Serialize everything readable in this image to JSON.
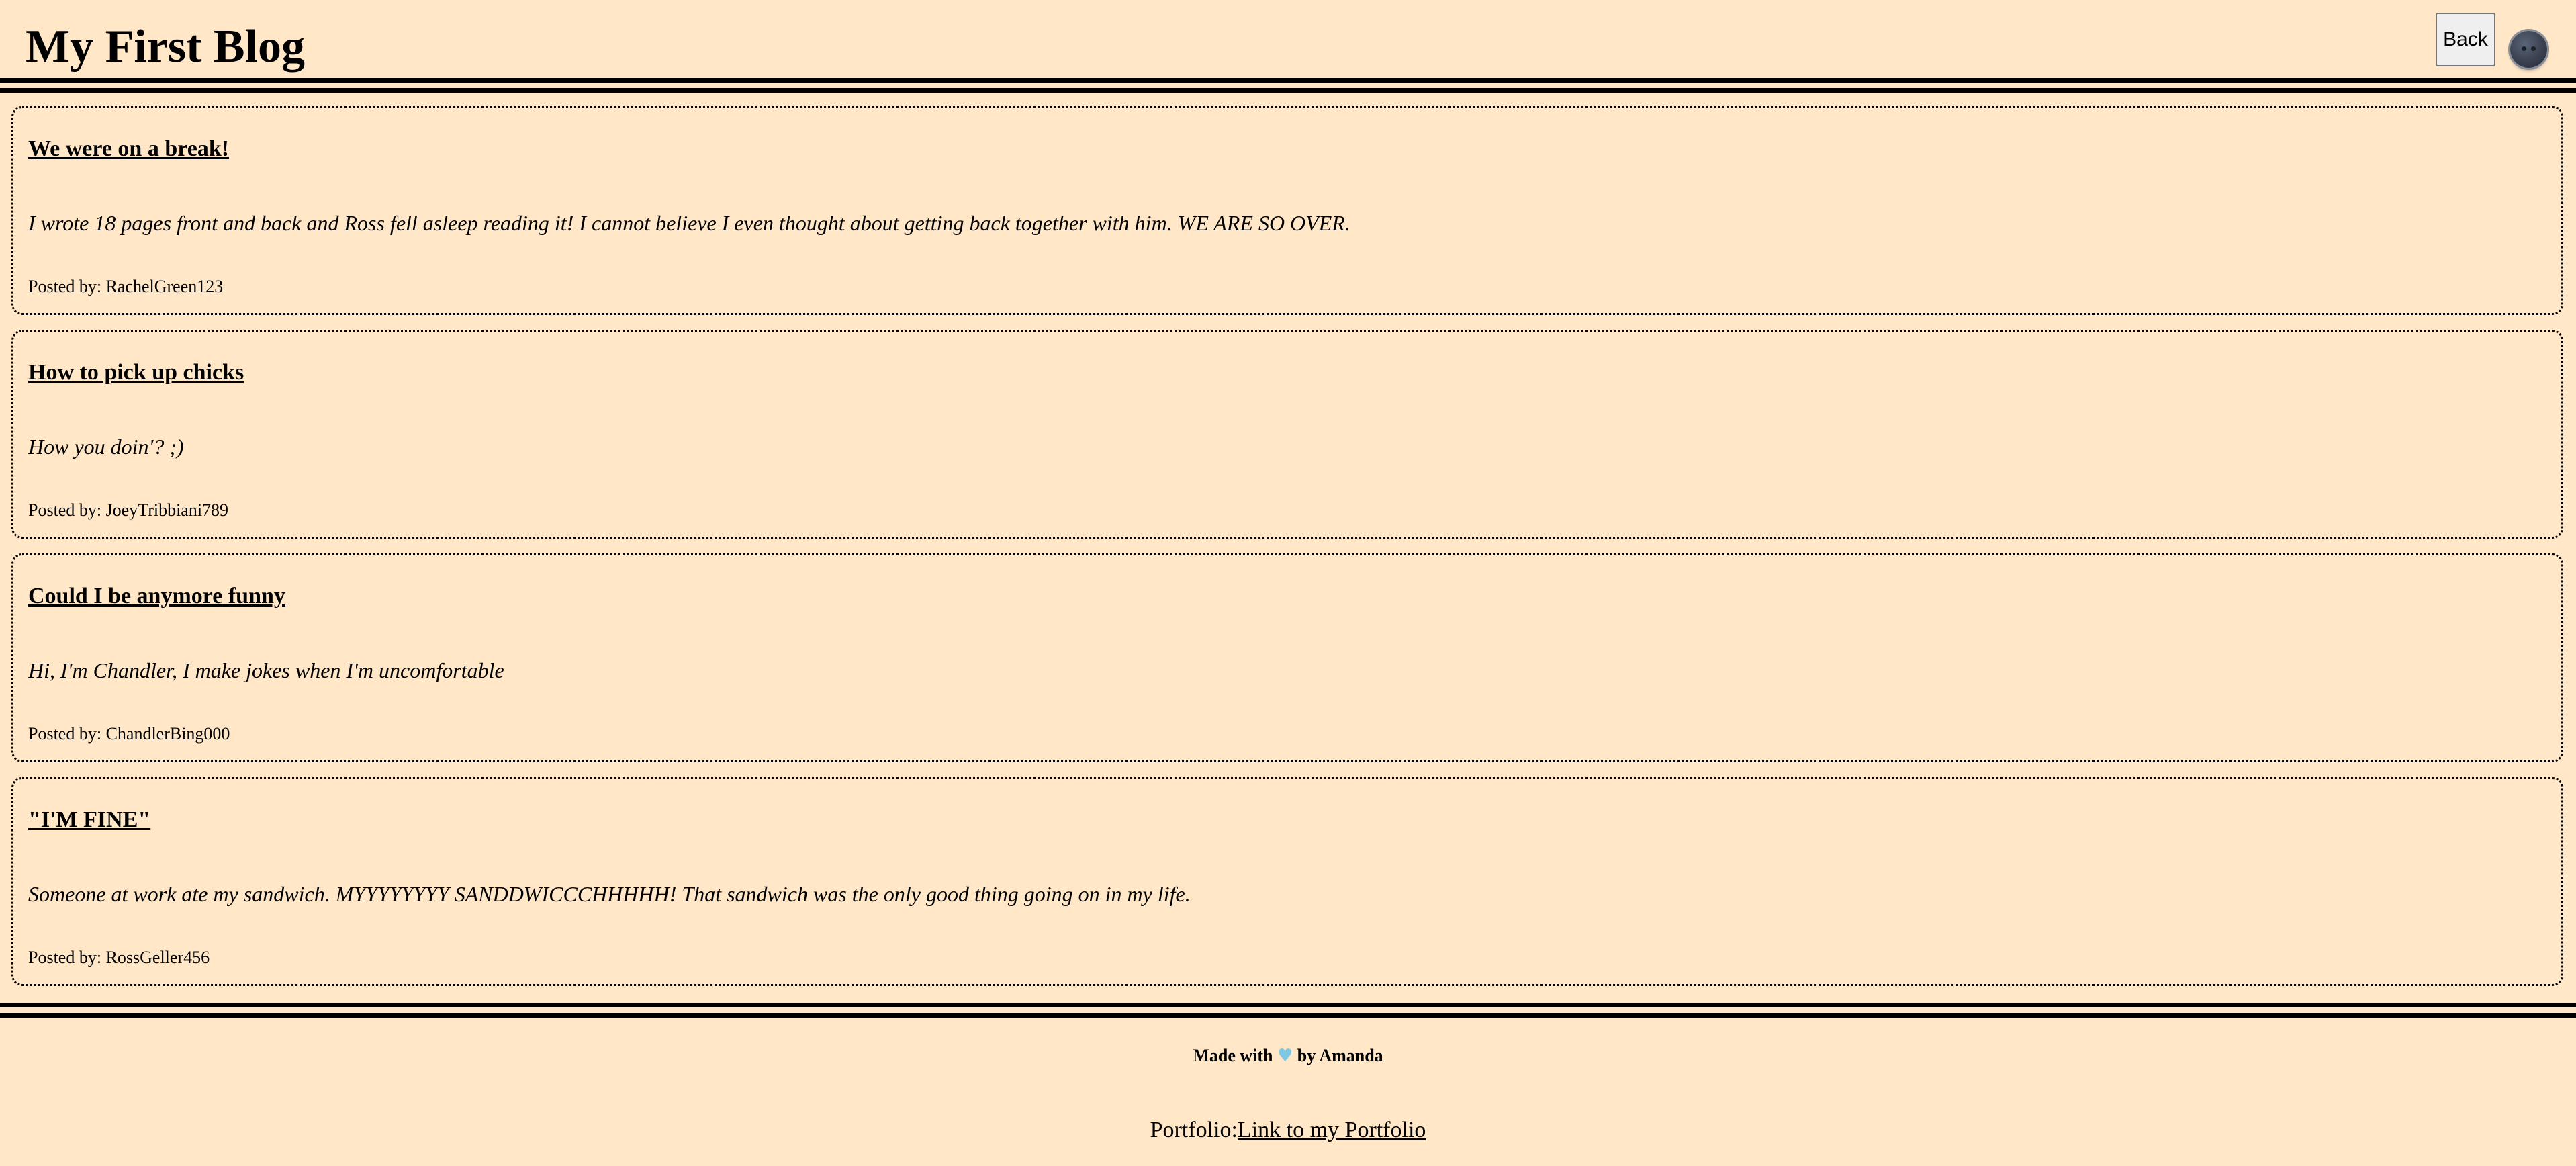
{
  "header": {
    "title": "My First Blog",
    "back_label": "Back",
    "theme_toggle_icon": "moon-face-icon"
  },
  "posts": [
    {
      "title": "We were on a break!",
      "body": "I wrote 18 pages front and back and Ross fell asleep reading it! I cannot believe I even thought about getting back together with him. WE ARE SO OVER.",
      "author": "Posted by: RachelGreen123"
    },
    {
      "title": "How to pick up chicks",
      "body": "How you doin'? ;)",
      "author": "Posted by: JoeyTribbiani789"
    },
    {
      "title": "Could I be anymore funny",
      "body": "Hi, I'm Chandler, I make jokes when I'm uncomfortable",
      "author": "Posted by: ChandlerBing000"
    },
    {
      "title": "\"I'M FINE\"",
      "body": "Someone at work ate my sandwich. MYYYYYYYY SANDDWICCCHHHHH! That sandwich was the only good thing going on in my life.",
      "author": "Posted by: RossGeller456"
    }
  ],
  "footer": {
    "made_with_prefix": "Made with",
    "heart": "♥",
    "made_with_suffix": "by Amanda",
    "portfolio_label": "Portfolio:",
    "portfolio_link": "Link to my Portfolio"
  },
  "colors": {
    "background": "#FFE7C8",
    "heart": "#7ec8e3"
  }
}
